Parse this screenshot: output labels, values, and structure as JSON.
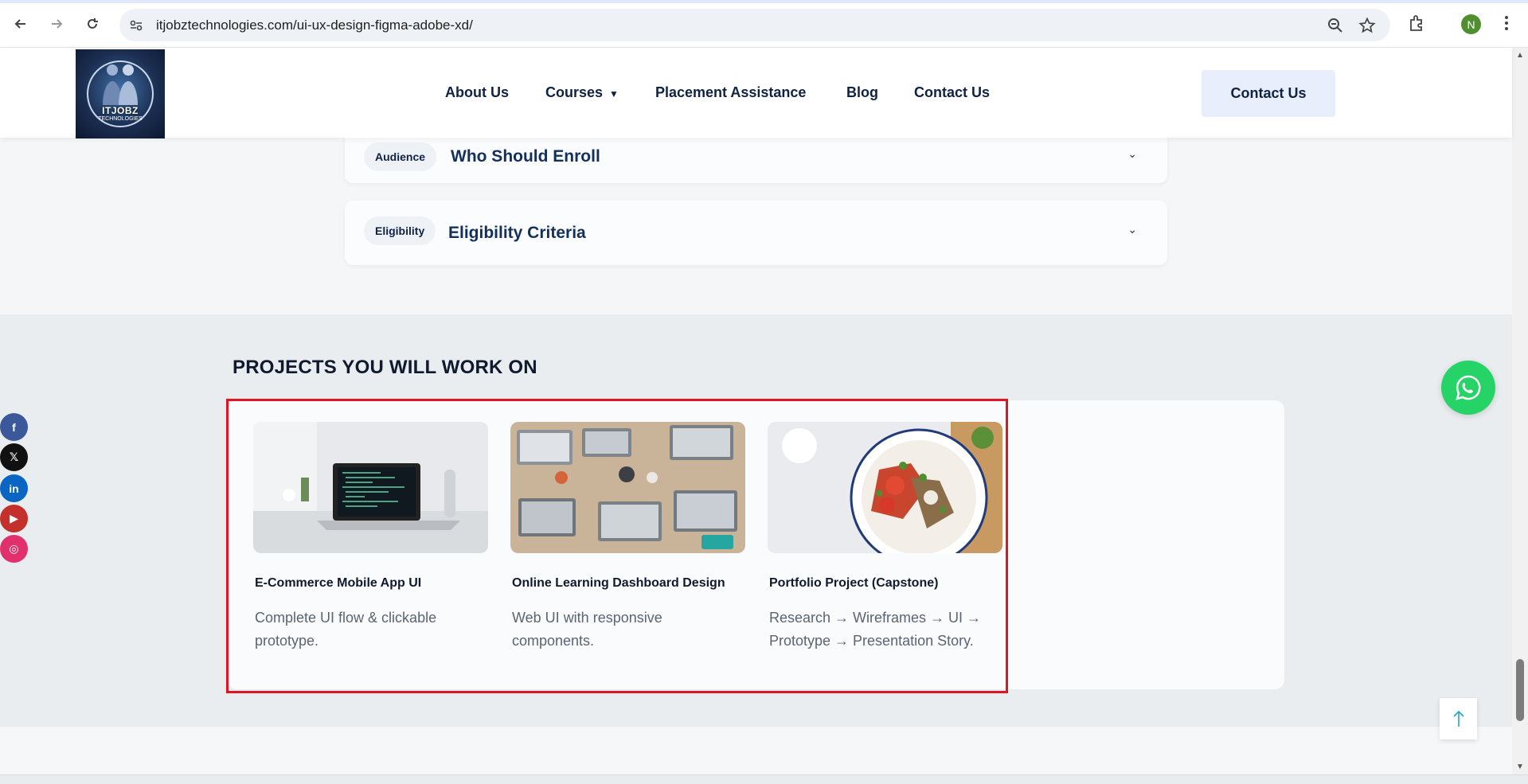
{
  "browser": {
    "url": "itjobztechnologies.com/ui-ux-design-figma-adobe-xd/",
    "profile_initial": "N",
    "icons": [
      "back-icon",
      "forward-icon",
      "reload-icon",
      "site-info-icon",
      "zoom-icon",
      "star-icon",
      "extensions-icon",
      "menu-icon"
    ]
  },
  "header": {
    "logo_text": "ITJOBZ",
    "logo_subtext": "TECHNOLOGIES",
    "nav": [
      {
        "label": "About Us"
      },
      {
        "label": "Courses",
        "caret": "▼"
      },
      {
        "label": "Placement Assistance"
      },
      {
        "label": "Blog"
      },
      {
        "label": "Contact Us"
      }
    ],
    "cta": "Contact Us"
  },
  "accordion": [
    {
      "tag": "Audience",
      "title": "Who Should Enroll",
      "chevron": "⌄"
    },
    {
      "tag": "Eligibility",
      "title": "Eligibility Criteria",
      "chevron": "⌄"
    }
  ],
  "projects": {
    "heading": "PROJECTS YOU WILL WORK ON",
    "items": [
      {
        "title": "E-Commerce Mobile App UI",
        "desc": "Complete UI flow & clickable prototype.",
        "image": "laptop-code-image"
      },
      {
        "title": "Online Learning Dashboard Design",
        "desc": "Web UI with responsive components.",
        "image": "team-laptops-image"
      },
      {
        "title": "Portfolio Project (Capstone)",
        "desc": "Research → Wireframes → UI → Prototype → Presentation Story.",
        "image": "salad-bowl-image"
      }
    ]
  },
  "social": [
    {
      "name": "facebook",
      "glyph": "f",
      "color": "#3b5998"
    },
    {
      "name": "x",
      "glyph": "𝕏",
      "color": "#111111"
    },
    {
      "name": "linkedin",
      "glyph": "in",
      "color": "#0a66c2"
    },
    {
      "name": "youtube",
      "glyph": "▶",
      "color": "#c4302b"
    },
    {
      "name": "instagram",
      "glyph": "◎",
      "color": "#e1306c"
    }
  ],
  "colors": {
    "accent_navy": "#0f2244",
    "highlight_red": "#e0151f",
    "whatsapp_green": "#25d366"
  }
}
